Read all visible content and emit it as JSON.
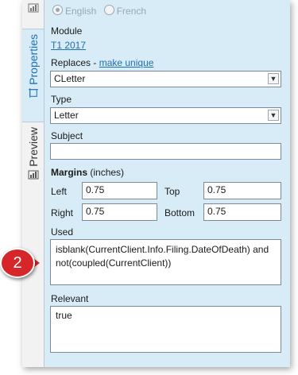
{
  "tabs": [
    {
      "label": "Properties",
      "icon": "properties-icon",
      "active": true
    },
    {
      "label": "Preview",
      "icon": "preview-icon",
      "active": false
    }
  ],
  "language": {
    "options": [
      "English",
      "French"
    ],
    "selected": "English"
  },
  "module": {
    "label": "Module",
    "value": "T1 2017"
  },
  "replaces": {
    "label": "Replaces - ",
    "link": "make unique",
    "value": "CLetter"
  },
  "type": {
    "label": "Type",
    "value": "Letter"
  },
  "subject": {
    "label": "Subject",
    "value": ""
  },
  "margins": {
    "title": "Margins",
    "unit": "(inches)",
    "left": {
      "label": "Left",
      "value": "0.75"
    },
    "top": {
      "label": "Top",
      "value": "0.75"
    },
    "right": {
      "label": "Right",
      "value": "0.75"
    },
    "bottom": {
      "label": "Bottom",
      "value": "0.75"
    }
  },
  "used": {
    "label": "Used",
    "value": "isblank(CurrentClient.Info.Filing.DateOfDeath) and not(coupled(CurrentClient))"
  },
  "relevant": {
    "label": "Relevant",
    "value": "true"
  },
  "callout": {
    "number": "2",
    "color": "#d6262a"
  },
  "colors": {
    "panel": "#d7ecf6",
    "link": "#1f6fb2"
  }
}
